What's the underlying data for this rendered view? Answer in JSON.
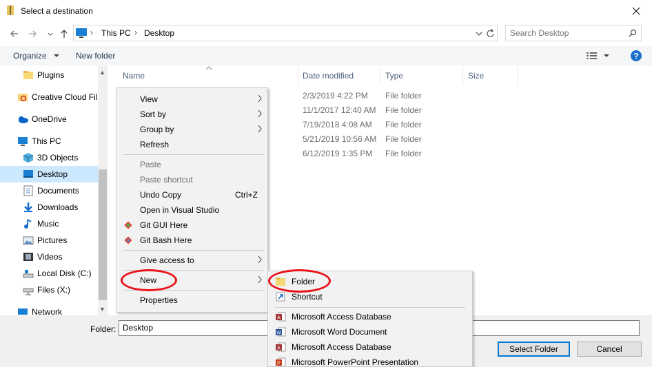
{
  "window": {
    "title": "Select a destination"
  },
  "address": {
    "crumbs": [
      "This PC",
      "Desktop"
    ],
    "search_placeholder": "Search Desktop"
  },
  "toolbar": {
    "organize": "Organize",
    "new_folder": "New folder"
  },
  "sidebar": {
    "items": [
      {
        "label": "Plugins",
        "icon": "folder-icon"
      },
      {
        "label": "Creative Cloud Fil",
        "icon": "creative-cloud-icon"
      },
      {
        "label": "OneDrive",
        "icon": "onedrive-icon"
      },
      {
        "label": "This PC",
        "icon": "pc-icon"
      },
      {
        "label": "3D Objects",
        "icon": "cube-icon"
      },
      {
        "label": "Desktop",
        "icon": "desktop-icon",
        "selected": true
      },
      {
        "label": "Documents",
        "icon": "documents-icon"
      },
      {
        "label": "Downloads",
        "icon": "download-icon"
      },
      {
        "label": "Music",
        "icon": "music-icon"
      },
      {
        "label": "Pictures",
        "icon": "pictures-icon"
      },
      {
        "label": "Videos",
        "icon": "videos-icon"
      },
      {
        "label": "Local Disk (C:)",
        "icon": "disk-icon"
      },
      {
        "label": "Files (X:)",
        "icon": "network-drive-icon"
      },
      {
        "label": "Network",
        "icon": "network-icon"
      }
    ]
  },
  "columns": {
    "name": "Name",
    "date": "Date modified",
    "type": "Type",
    "size": "Size"
  },
  "rows": [
    {
      "date": "2/3/2019 4:22 PM",
      "type": "File folder"
    },
    {
      "date": "11/1/2017 12:40 AM",
      "type": "File folder"
    },
    {
      "date": "7/19/2018 4:08 AM",
      "type": "File folder"
    },
    {
      "date": "5/21/2019 10:56 AM",
      "type": "File folder"
    },
    {
      "date": "6/12/2019 1:35 PM",
      "type": "File folder"
    }
  ],
  "context_menu": {
    "view": "View",
    "sort_by": "Sort by",
    "group_by": "Group by",
    "refresh": "Refresh",
    "paste": "Paste",
    "paste_shortcut": "Paste shortcut",
    "undo_copy": "Undo Copy",
    "undo_shortcut": "Ctrl+Z",
    "open_vs": "Open in Visual Studio",
    "git_gui": "Git GUI Here",
    "git_bash": "Git Bash Here",
    "give_access": "Give access to",
    "new": "New",
    "properties": "Properties"
  },
  "new_submenu": {
    "folder": "Folder",
    "shortcut": "Shortcut",
    "access_db_1": "Microsoft Access Database",
    "word_doc": "Microsoft Word Document",
    "access_db_2": "Microsoft Access Database",
    "powerpoint": "Microsoft PowerPoint Presentation"
  },
  "footer": {
    "folder_label": "Folder:",
    "folder_value": "Desktop",
    "select_button": "Select Folder",
    "cancel_button": "Cancel"
  },
  "colors": {
    "accent": "#0078d7",
    "annotation": "#e8141b",
    "selection": "#cce8ff"
  }
}
